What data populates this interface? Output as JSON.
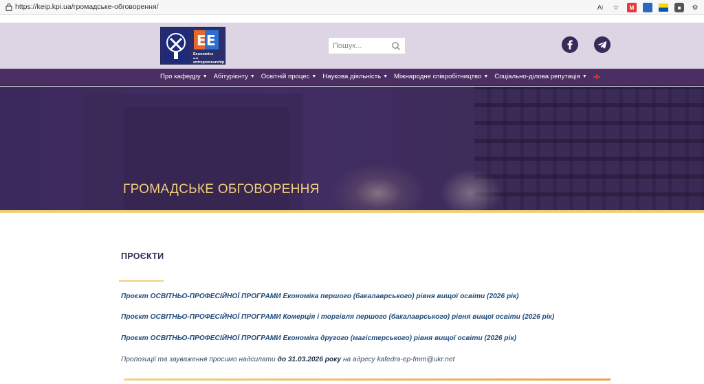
{
  "browser": {
    "url": "https://keip.kpi.ua/громадське-обговорення/",
    "icons": [
      "read-aloud-icon",
      "favorite-star-icon",
      "extension-icon",
      "extension-icon",
      "extension-icon",
      "extension-icon",
      "extension-icon"
    ]
  },
  "header": {
    "logo_text_1": "Economics",
    "logo_text_2": "and",
    "logo_text_3": "entrepreneurship",
    "search_placeholder": "Пошук..."
  },
  "nav": {
    "items": [
      "Про кафедру",
      "Абітурієнту",
      "Освітній процес",
      "Наукова діяльність",
      "Міжнародне співробітництво",
      "Соціально-ділова репутація"
    ]
  },
  "hero": {
    "title": "ГРОМАДСЬКЕ ОБГОВОРЕННЯ"
  },
  "content": {
    "section_title": "ПРОЄКТИ",
    "links": [
      "Проєкт ОСВІТНЬО-ПРОФЕСІЙНОЇ ПРОГРАМИ Економіка першого (бакалаврського) рівня вищої освіти (2026 рік)",
      "Проєкт ОСВІТНЬО-ПРОФЕСІЙНОЇ ПРОГРАМИ Комерція і торгівля першого (бакалаврського) рівня вищої освіти (2026 рік)",
      "Проєкт ОСВІТНЬО-ПРОФЕСІЙНОЇ ПРОГРАМИ Економіка другого (магістерського) рівня вищої освіти (2026 рік)"
    ],
    "note_prefix": "Пропозиції та зауваження просимо надсилати ",
    "note_deadline": "до 31.03.2026 року",
    "note_suffix": " на адресу kafedra-ep-fmm@ukr.net"
  },
  "colors": {
    "nav_bg": "#4b2f63",
    "header_bg": "#ddd4e4",
    "accent_gold": "#f0cf7d",
    "link_blue": "#1f4b7a"
  }
}
